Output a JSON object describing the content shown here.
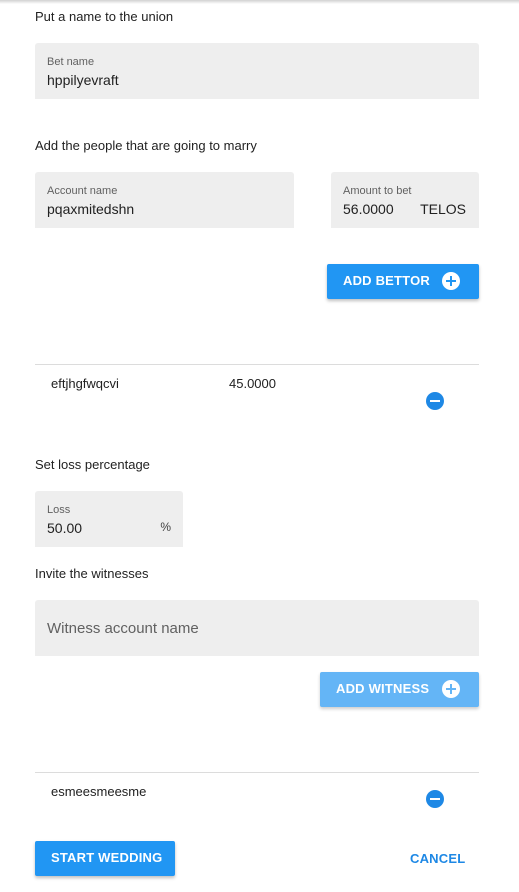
{
  "colors": {
    "primary": "#2196f3",
    "primary_disabled": "#64b5f6",
    "field_bg": "#eeeeee",
    "cancel_text": "#1e88e5"
  },
  "union": {
    "section_label": "Put a name to the union",
    "bet_name": {
      "label": "Bet name",
      "value": "hppilyevraft"
    }
  },
  "people": {
    "section_label": "Add the people that are going to marry",
    "account_name": {
      "label": "Account name",
      "value": "pqaxmitedshn"
    },
    "amount": {
      "label": "Amount to bet",
      "value": "56.0000",
      "suffix": "TELOS"
    },
    "add_bettor_label": "ADD BETTOR",
    "bettors": [
      {
        "account": "eftjhgfwqcvi",
        "amount": "45.0000"
      }
    ]
  },
  "loss": {
    "section_label": "Set loss percentage",
    "field": {
      "label": "Loss",
      "value": "50.00",
      "suffix": "%"
    }
  },
  "witnesses": {
    "section_label": "Invite the witnesses",
    "input_placeholder": "Witness account name",
    "add_witness_label": "ADD WITNESS",
    "list": [
      {
        "account": "esmeesmeesme"
      }
    ]
  },
  "actions": {
    "start_label": "START WEDDING",
    "cancel_label": "CANCEL"
  }
}
